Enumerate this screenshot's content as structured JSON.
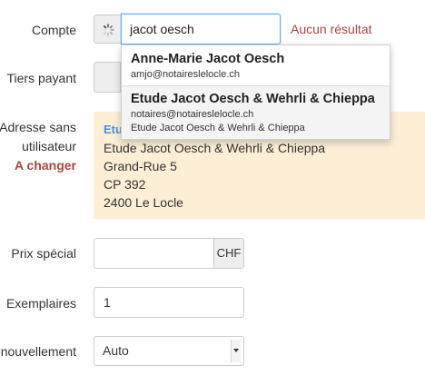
{
  "form": {
    "compte_label": "Compte",
    "tiers_label": "Tiers payant",
    "adresse_label_1": "Adresse sans",
    "adresse_label_2": "utilisateur",
    "a_changer": "A changer",
    "prix_label": "Prix spécial",
    "prix_unit": "CHF",
    "prix_value": "",
    "exemplaires_label": "Exemplaires",
    "exemplaires_value": "1",
    "renouvellement_label": "enouvellement",
    "renouvellement_value": "Auto"
  },
  "search": {
    "value": "jacot oesch",
    "status": "Aucun résultat"
  },
  "dropdown": {
    "items": [
      {
        "name": "Anne-Marie Jacot Oesch",
        "email": "amjo@notaireslelocle.ch",
        "org": ""
      },
      {
        "name": "Etude Jacot Oesch & Wehrli & Chieppa",
        "email": "notaires@notaireslelocle.ch",
        "org": "Etude Jacot Oesch & Wehrli & Chieppa"
      }
    ]
  },
  "address": {
    "link": "Etu",
    "lines": [
      "Etude Jacot Oesch & Wehrli & Chieppa",
      "Grand-Rue 5",
      "CP 392",
      "2400 Le Locle"
    ]
  },
  "colors": {
    "accent_red": "#a94442",
    "address_bg": "#fcefd6",
    "link_blue": "#4a90e2",
    "focus_blue": "#66afe9"
  },
  "icons": {
    "spinner": "loading-spinner-icon",
    "select_arrow": "chevron-down-icon"
  }
}
